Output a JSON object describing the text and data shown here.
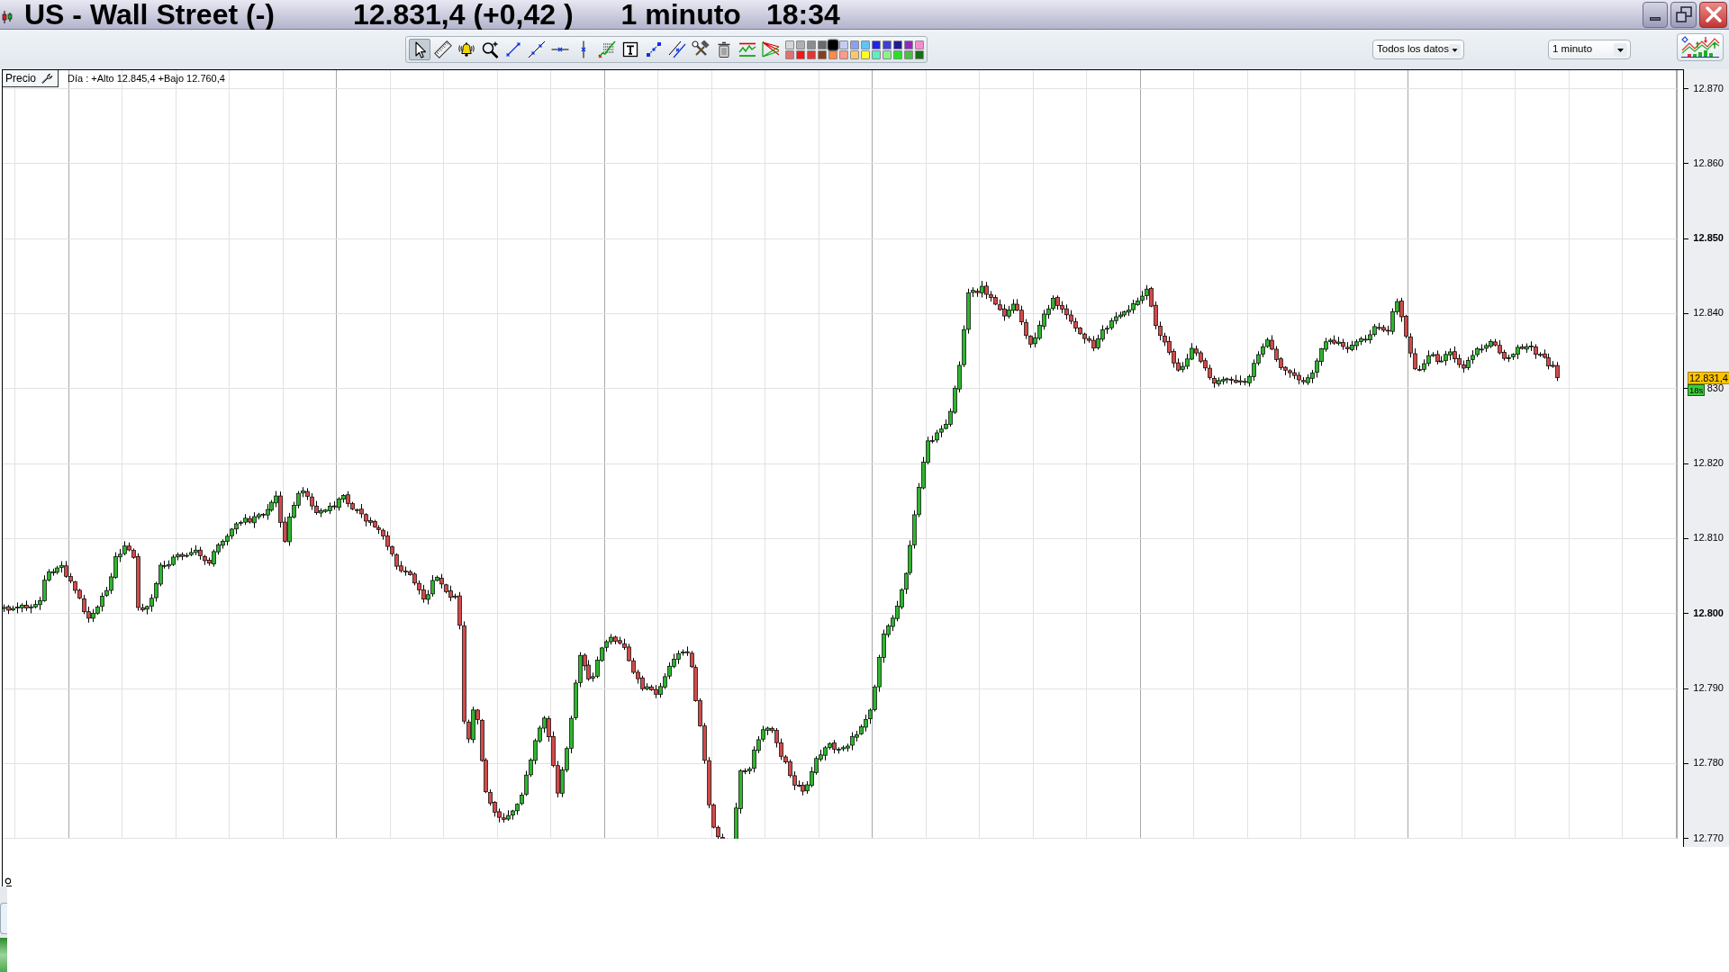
{
  "window": {
    "title": {
      "instrument": "US - Wall Street (-)",
      "quote": "12.831,4 (+0,42 )",
      "interval": "1 minuto",
      "time": "18:34"
    }
  },
  "toolbar": {
    "drawing_tools": [
      {
        "kind": "pointer",
        "selected": true
      },
      {
        "kind": "ruler",
        "selected": false
      },
      {
        "kind": "alert",
        "selected": false
      },
      {
        "kind": "zoom",
        "selected": false
      },
      {
        "kind": "segment",
        "selected": false
      },
      {
        "kind": "line",
        "selected": false
      },
      {
        "kind": "horizontal",
        "selected": false
      },
      {
        "kind": "vertical",
        "selected": false
      },
      {
        "kind": "levels",
        "selected": false
      },
      {
        "kind": "text",
        "selected": false
      },
      {
        "kind": "channel",
        "selected": false
      },
      {
        "kind": "parallel",
        "selected": false
      },
      {
        "kind": "tools",
        "selected": false
      },
      {
        "kind": "delete",
        "selected": false
      },
      {
        "kind": "indicator",
        "selected": false
      },
      {
        "kind": "fan",
        "selected": false
      }
    ],
    "palette": [
      {
        "color": "#d6d6d6",
        "selected": false
      },
      {
        "color": "#b0b0b0",
        "selected": false
      },
      {
        "color": "#8c8c8c",
        "selected": false
      },
      {
        "color": "#6a6a6a",
        "selected": false
      },
      {
        "color": "#000000",
        "selected": true
      },
      {
        "color": "#c4ccf6",
        "selected": false
      },
      {
        "color": "#8aa2ee",
        "selected": false
      },
      {
        "color": "#5ec4f6",
        "selected": false
      },
      {
        "color": "#2424e6",
        "selected": false
      },
      {
        "color": "#3e40d2",
        "selected": false
      },
      {
        "color": "#1e1e92",
        "selected": false
      },
      {
        "color": "#9626c4",
        "selected": false
      },
      {
        "color": "#f28ecc",
        "selected": false
      },
      {
        "color": "#e27070",
        "selected": false
      },
      {
        "color": "#fa1414",
        "selected": false
      },
      {
        "color": "#e03636",
        "selected": false
      },
      {
        "color": "#86401c",
        "selected": false
      },
      {
        "color": "#ff8a48",
        "selected": false
      },
      {
        "color": "#ff9a88",
        "selected": false
      },
      {
        "color": "#ffc868",
        "selected": false
      },
      {
        "color": "#ffff22",
        "selected": false
      },
      {
        "color": "#5cf0c2",
        "selected": false
      },
      {
        "color": "#8cf08c",
        "selected": false
      },
      {
        "color": "#22e422",
        "selected": false
      },
      {
        "color": "#46c046",
        "selected": false
      },
      {
        "color": "#166e16",
        "selected": false
      }
    ],
    "range_select": {
      "value": "Todos los datos"
    },
    "interval_select": {
      "value": "1 minuto"
    }
  },
  "chart": {
    "panel_label": "Precio",
    "day_summary": "Día : +Alto 12.845,4 +Bajo 12.760,4",
    "price_axis": [
      {
        "label": "12.870",
        "major": false
      },
      {
        "label": "12.860",
        "major": false
      },
      {
        "label": "12.850",
        "major": true
      },
      {
        "label": "12.840",
        "major": false
      },
      {
        "label": "830",
        "major": false
      },
      {
        "label": "12.820",
        "major": false
      },
      {
        "label": "12.810",
        "major": false
      },
      {
        "label": "12.800",
        "major": true
      },
      {
        "label": "12.790",
        "major": false
      },
      {
        "label": "12.780",
        "major": false
      },
      {
        "label": "12.770",
        "major": false
      }
    ],
    "last_price": "12.831,4",
    "countdown": "18s"
  }
}
